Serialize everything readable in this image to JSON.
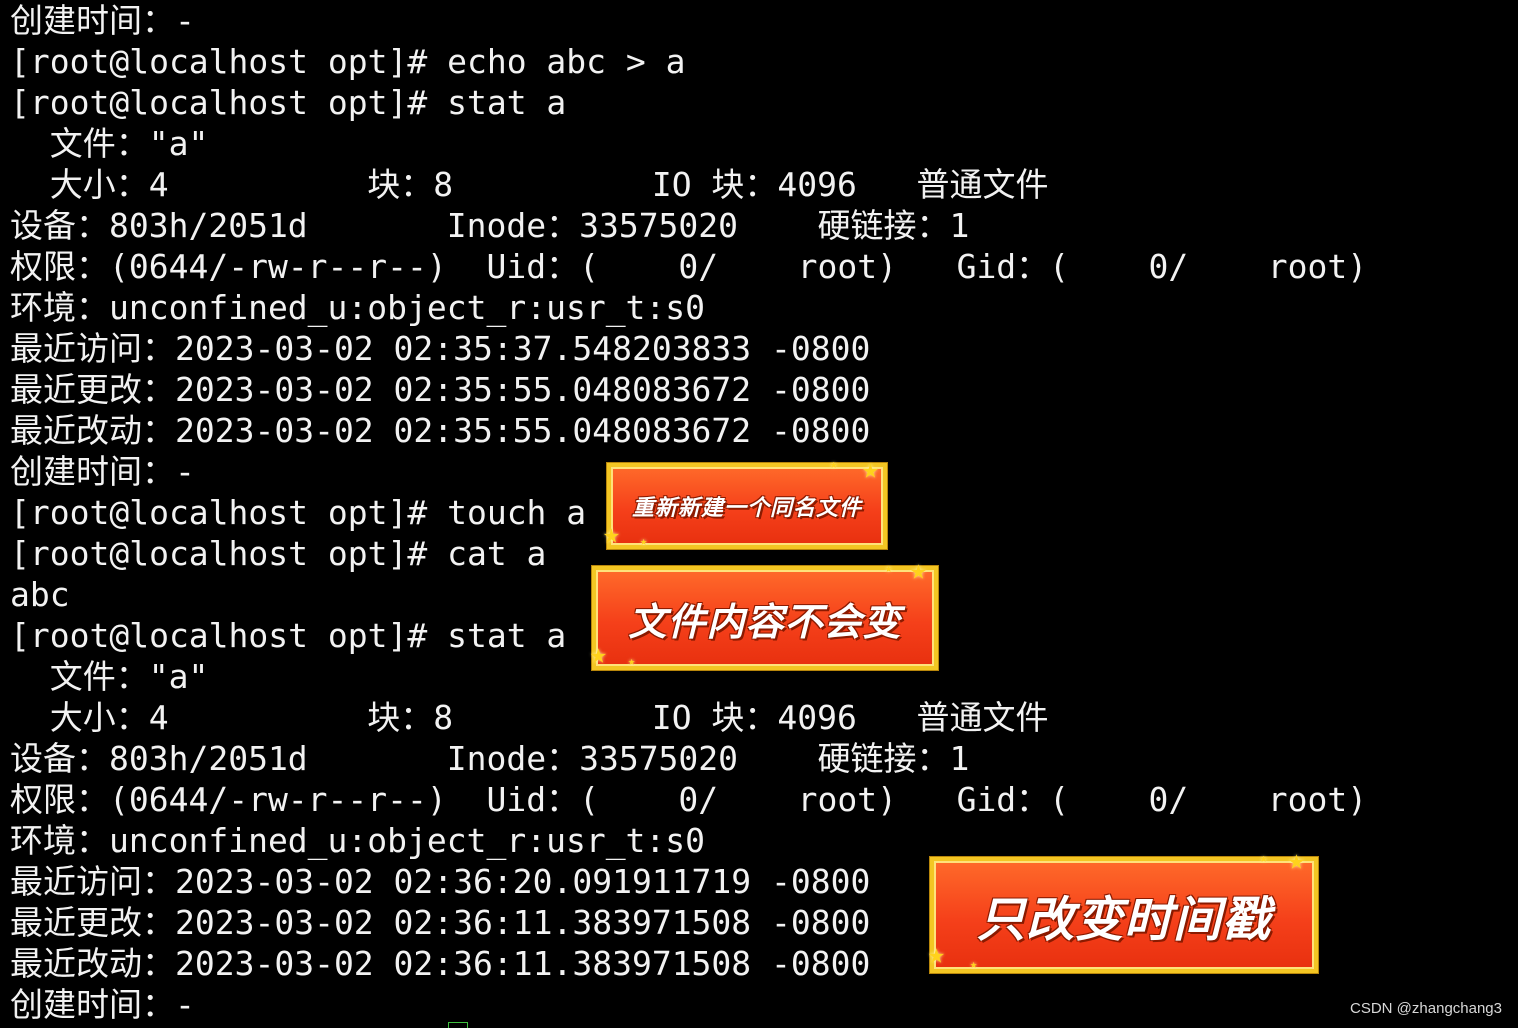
{
  "terminal": {
    "lines": [
      "创建时间：-",
      "[root@localhost opt]# echo abc > a",
      "[root@localhost opt]# stat a",
      "  文件：\"a\"",
      "  大小：4          块：8          IO 块：4096   普通文件",
      "设备：803h/2051d       Inode：33575020    硬链接：1",
      "权限：(0644/-rw-r--r--)  Uid：(    0/    root)   Gid：(    0/    root)",
      "环境：unconfined_u:object_r:usr_t:s0",
      "最近访问：2023-03-02 02:35:37.548203833 -0800",
      "最近更改：2023-03-02 02:35:55.048083672 -0800",
      "最近改动：2023-03-02 02:35:55.048083672 -0800",
      "创建时间：-",
      "[root@localhost opt]# touch a",
      "[root@localhost opt]# cat a",
      "abc",
      "[root@localhost opt]# stat a",
      "  文件：\"a\"",
      "  大小：4          块：8          IO 块：4096   普通文件",
      "设备：803h/2051d       Inode：33575020    硬链接：1",
      "权限：(0644/-rw-r--r--)  Uid：(    0/    root)   Gid：(    0/    root)",
      "环境：unconfined_u:object_r:usr_t:s0",
      "最近访问：2023-03-02 02:36:20.091911719 -0800",
      "最近更改：2023-03-02 02:36:11.383971508 -0800",
      "最近改动：2023-03-02 02:36:11.383971508 -0800",
      "创建时间：-"
    ]
  },
  "annotations": {
    "new_file": "重新新建一个同名文件",
    "content_same": "文件内容不会变",
    "timestamp_only": "只改变时间戳"
  },
  "watermark": "CSDN @zhangchang3",
  "colors": {
    "background": "#000000",
    "text": "#f2f2f2",
    "sticker_fill": "#f5401a",
    "sticker_border": "#f3c623"
  }
}
